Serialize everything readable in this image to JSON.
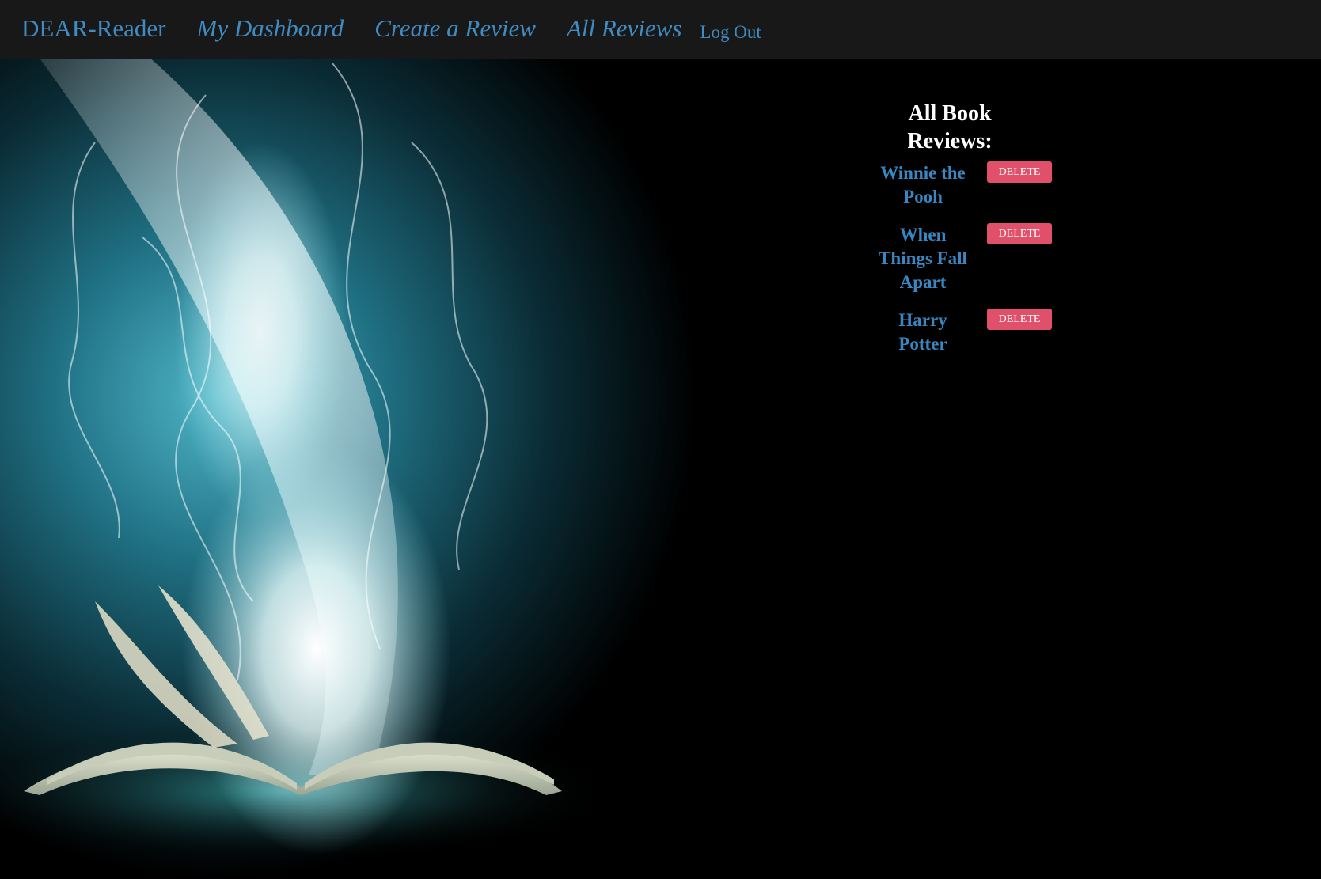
{
  "nav": {
    "brand": "DEAR-Reader",
    "dashboard": "My Dashboard",
    "create_review": "Create a Review",
    "all_reviews": "All Reviews",
    "logout": "Log Out"
  },
  "reviews": {
    "heading": "All Book Reviews:",
    "delete_label": "DELETE",
    "items": [
      {
        "title": "Winnie the Pooh"
      },
      {
        "title": "When Things Fall Apart"
      },
      {
        "title": "Harry Potter"
      }
    ]
  },
  "colors": {
    "nav_bg": "#181818",
    "link": "#3f8bc2",
    "delete_bg": "#e0506a",
    "page_bg": "#000000"
  },
  "background_image": "open-book-magic-light-illustration"
}
